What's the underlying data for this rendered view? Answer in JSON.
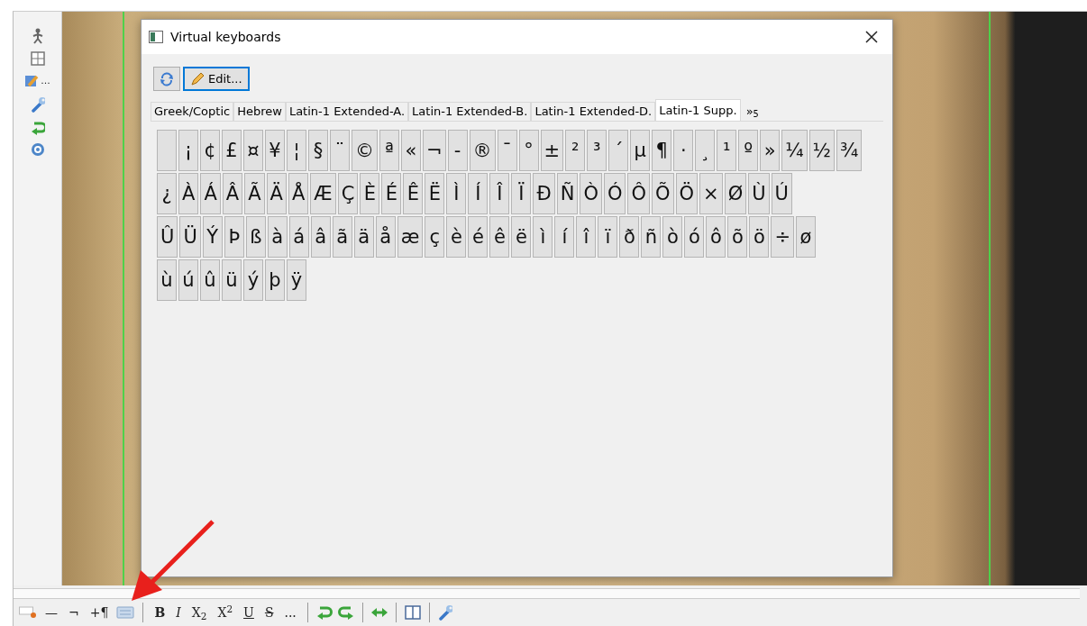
{
  "sidebar": {
    "more_label": "..."
  },
  "window": {
    "title": "Virtual keyboards"
  },
  "dialog_toolbar": {
    "edit_button": "Edit..."
  },
  "tabs": [
    {
      "label": "Greek/Coptic",
      "selected": false
    },
    {
      "label": "Hebrew",
      "selected": false
    },
    {
      "label": "Latin-1 Extended-A.",
      "selected": false
    },
    {
      "label": "Latin-1 Extended-B.",
      "selected": false
    },
    {
      "label": "Latin-1 Extended-D.",
      "selected": false
    },
    {
      "label": "Latin-1 Supp.",
      "selected": true
    }
  ],
  "tab_overflow": "»$_{5}$",
  "key_rows": [
    [
      " ",
      "¡",
      "¢",
      "£",
      "¤",
      "¥",
      "¦",
      "§",
      "¨",
      "©",
      "ª",
      "«",
      "¬",
      "-",
      "®",
      "¯",
      "°",
      "±",
      "²",
      "³",
      "´",
      "µ",
      "¶",
      "·",
      "¸",
      "¹",
      "º",
      "»",
      "¼",
      "½",
      "¾"
    ],
    [
      "¿",
      "À",
      "Á",
      "Â",
      "Ã",
      "Ä",
      "Å",
      "Æ",
      "Ç",
      "È",
      "É",
      "Ê",
      "Ë",
      "Ì",
      "Í",
      "Î",
      "Ï",
      "Ð",
      "Ñ",
      "Ò",
      "Ó",
      "Ô",
      "Õ",
      "Ö",
      "×",
      "Ø",
      "Ù",
      "Ú"
    ],
    [
      "Û",
      "Ü",
      "Ý",
      "Þ",
      "ß",
      "à",
      "á",
      "â",
      "ã",
      "ä",
      "å",
      "æ",
      "ç",
      "è",
      "é",
      "ê",
      "ë",
      "ì",
      "í",
      "î",
      "ï",
      "ð",
      "ñ",
      "ò",
      "ó",
      "ô",
      "õ",
      "ö",
      "÷",
      "ø"
    ],
    [
      "ù",
      "ú",
      "û",
      "ü",
      "ý",
      "þ",
      "ÿ"
    ]
  ],
  "bottom_toolbar": {
    "insert_buttons": [
      "—",
      "¬",
      "+¶"
    ],
    "format_buttons": [
      {
        "kind": "bold",
        "label": "B"
      },
      {
        "kind": "italic",
        "label": "I"
      },
      {
        "kind": "plain",
        "label": "X$_{2}$"
      },
      {
        "kind": "plain",
        "label": "X$^{2}$"
      },
      {
        "kind": "underline",
        "label": "U"
      },
      {
        "kind": "strike",
        "label": "S"
      },
      {
        "kind": "plain",
        "label": "..."
      }
    ]
  }
}
